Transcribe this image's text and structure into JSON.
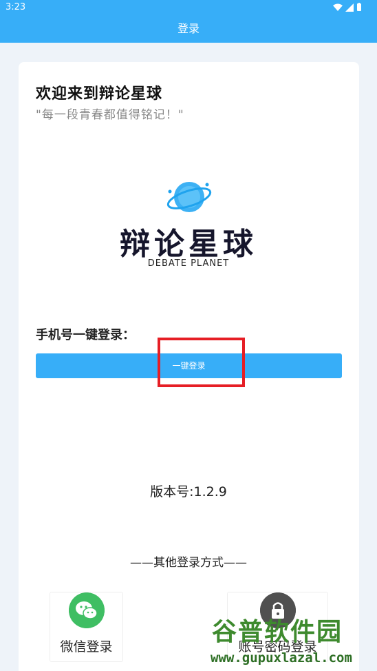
{
  "status_bar": {
    "time": "3:23"
  },
  "header": {
    "title": "登录"
  },
  "welcome": {
    "title": "欢迎来到辩论星球",
    "slogan": "\"每一段青春都值得铭记！\""
  },
  "logo": {
    "title": "辩论星球",
    "subtitle": "DEBATE PLANET"
  },
  "phone_login": {
    "label": "手机号一键登录：",
    "button_label": "一键登录"
  },
  "version": {
    "text": "版本号:1.2.9"
  },
  "other_login": {
    "divider_text": "——其他登录方式——",
    "options": [
      {
        "label": "微信登录",
        "icon": "wechat-icon"
      },
      {
        "label": "账号密码登录",
        "icon": "lock-icon"
      }
    ]
  },
  "watermark": {
    "main": "谷普软件园",
    "url": "www.gupuxlazal.com"
  },
  "colors": {
    "primary": "#37aef8",
    "highlight": "#e61e25",
    "wechat": "#3fbe63"
  }
}
